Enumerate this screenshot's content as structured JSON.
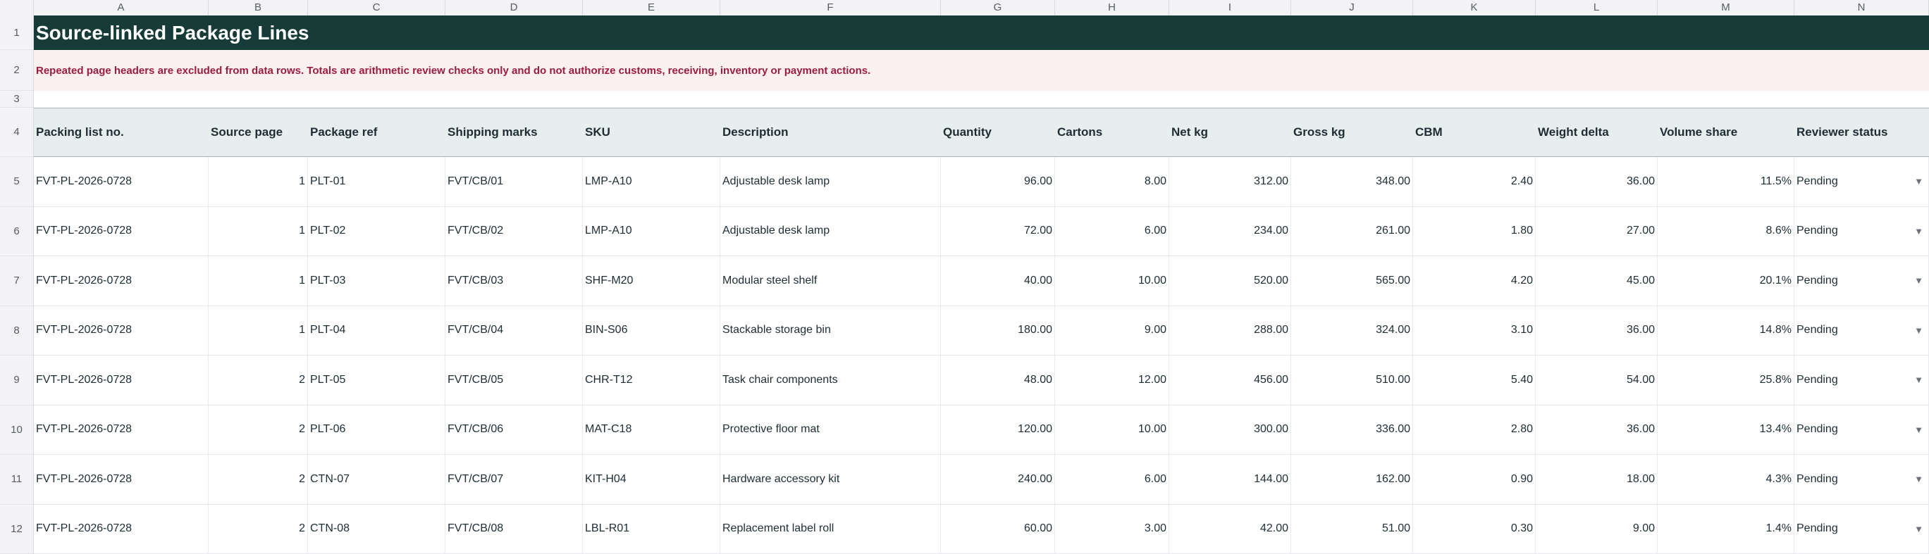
{
  "columns": [
    "A",
    "B",
    "C",
    "D",
    "E",
    "F",
    "G",
    "H",
    "I",
    "J",
    "K",
    "L",
    "M",
    "N"
  ],
  "row_numbers": [
    "1",
    "2",
    "3",
    "4",
    "5",
    "6",
    "7",
    "8",
    "9",
    "10",
    "11",
    "12"
  ],
  "title": "Source-linked Package Lines",
  "note": "Repeated page headers are excluded from data rows. Totals are arithmetic review checks only and do not authorize customs, receiving, inventory or payment actions.",
  "headers": [
    "Packing list no.",
    "Source page",
    "Package ref",
    "Shipping marks",
    "SKU",
    "Description",
    "Quantity",
    "Cartons",
    "Net kg",
    "Gross kg",
    "CBM",
    "Weight delta",
    "Volume share",
    "Reviewer status"
  ],
  "rows": [
    [
      "FVT-PL-2026-0728",
      "1",
      "PLT-01",
      "FVT/CB/01",
      "LMP-A10",
      "Adjustable desk lamp",
      "96.00",
      "8.00",
      "312.00",
      "348.00",
      "2.40",
      "36.00",
      "11.5%",
      "Pending"
    ],
    [
      "FVT-PL-2026-0728",
      "1",
      "PLT-02",
      "FVT/CB/02",
      "LMP-A10",
      "Adjustable desk lamp",
      "72.00",
      "6.00",
      "234.00",
      "261.00",
      "1.80",
      "27.00",
      "8.6%",
      "Pending"
    ],
    [
      "FVT-PL-2026-0728",
      "1",
      "PLT-03",
      "FVT/CB/03",
      "SHF-M20",
      "Modular steel shelf",
      "40.00",
      "10.00",
      "520.00",
      "565.00",
      "4.20",
      "45.00",
      "20.1%",
      "Pending"
    ],
    [
      "FVT-PL-2026-0728",
      "1",
      "PLT-04",
      "FVT/CB/04",
      "BIN-S06",
      "Stackable storage bin",
      "180.00",
      "9.00",
      "288.00",
      "324.00",
      "3.10",
      "36.00",
      "14.8%",
      "Pending"
    ],
    [
      "FVT-PL-2026-0728",
      "2",
      "PLT-05",
      "FVT/CB/05",
      "CHR-T12",
      "Task chair components",
      "48.00",
      "12.00",
      "456.00",
      "510.00",
      "5.40",
      "54.00",
      "25.8%",
      "Pending"
    ],
    [
      "FVT-PL-2026-0728",
      "2",
      "PLT-06",
      "FVT/CB/06",
      "MAT-C18",
      "Protective floor mat",
      "120.00",
      "10.00",
      "300.00",
      "336.00",
      "2.80",
      "36.00",
      "13.4%",
      "Pending"
    ],
    [
      "FVT-PL-2026-0728",
      "2",
      "CTN-07",
      "FVT/CB/07",
      "KIT-H04",
      "Hardware accessory kit",
      "240.00",
      "6.00",
      "144.00",
      "162.00",
      "0.90",
      "18.00",
      "4.3%",
      "Pending"
    ],
    [
      "FVT-PL-2026-0728",
      "2",
      "CTN-08",
      "FVT/CB/08",
      "LBL-R01",
      "Replacement label roll",
      "60.00",
      "3.00",
      "42.00",
      "51.00",
      "0.30",
      "9.00",
      "1.4%",
      "Pending"
    ]
  ],
  "dropdown_icon": "chevron-down-icon",
  "colors": {
    "title_bg": "#173c37",
    "note_bg": "#fdf0f1",
    "note_text": "#9b1d3c",
    "header_bg": "#e6efed"
  }
}
